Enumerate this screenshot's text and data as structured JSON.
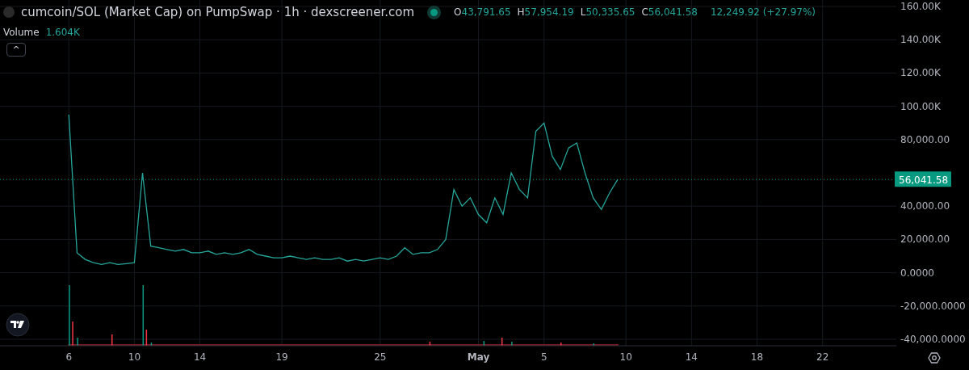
{
  "legend": {
    "title": "cumcoin/SOL (Market Cap) on PumpSwap · 1h · dexscreener.com",
    "ohlc": [
      {
        "letter": "O",
        "value": "43,791.65"
      },
      {
        "letter": "H",
        "value": "57,954.19"
      },
      {
        "letter": "L",
        "value": "50,335.65"
      },
      {
        "letter": "C",
        "value": "56,041.58"
      }
    ],
    "change": "12,249.92 (+27.97%)",
    "volume_label": "Volume",
    "volume_value": "1.604K",
    "collapse_button": "^"
  },
  "price_badge": "56,041.58",
  "may_axis_labels": [
    "May",
    "5",
    "10",
    "14",
    "18",
    "22"
  ],
  "chart_data": {
    "type": "line",
    "grid": true,
    "xlim": [
      1.8,
      56.5
    ],
    "ylim": [
      -40000,
      160000
    ],
    "xticks": [
      6,
      10,
      14,
      19,
      25
    ],
    "yticks": [
      {
        "value": 160000,
        "label": "160.00K"
      },
      {
        "value": 140000,
        "label": "140.00K"
      },
      {
        "value": 120000,
        "label": "120.00K"
      },
      {
        "value": 100000,
        "label": "100.00K"
      },
      {
        "value": 80000,
        "label": "80,000.00"
      },
      {
        "value": 40000,
        "label": "40,000.00"
      },
      {
        "value": 20000,
        "label": "20,000.00"
      },
      {
        "value": 0,
        "label": "0.0000"
      },
      {
        "value": -20000,
        "label": "-20,000.0000"
      },
      {
        "value": -40000,
        "label": "-40,000.0000"
      }
    ],
    "x": [
      6,
      6.5,
      7,
      7.5,
      8,
      8.5,
      9,
      9.5,
      10,
      10.5,
      11,
      11.5,
      12,
      12.5,
      13,
      13.5,
      14,
      14.5,
      15,
      15.5,
      16,
      16.5,
      17,
      17.5,
      18,
      18.5,
      19,
      19.5,
      20,
      20.5,
      21,
      21.5,
      22,
      22.5,
      23,
      23.5,
      24,
      24.5,
      25,
      25.5,
      26,
      26.5,
      27,
      27.5,
      28,
      28.5,
      29,
      29.5,
      30,
      30.5,
      31,
      31.5,
      32,
      32.5,
      33,
      33.5,
      34,
      34.5,
      35,
      35.5,
      36,
      36.5,
      37,
      37.5,
      38,
      38.5,
      39,
      39.5
    ],
    "series": [
      {
        "color": "#26a69a",
        "values": [
          95000,
          12000,
          8000,
          6000,
          5000,
          6000,
          5000,
          5500,
          6000,
          60000,
          16000,
          15000,
          14000,
          13000,
          14000,
          12000,
          12000,
          13000,
          11000,
          12000,
          11000,
          12000,
          14000,
          11000,
          10000,
          9000,
          9000,
          10000,
          9000,
          8000,
          9000,
          8000,
          8000,
          9000,
          7000,
          8000,
          7000,
          8000,
          9000,
          8000,
          10000,
          15000,
          11000,
          12000,
          12000,
          14000,
          20000,
          50000,
          40000,
          45000,
          35000,
          30000,
          45000,
          35000,
          60000,
          50000,
          45000,
          85000,
          90000,
          70000,
          62000,
          75000,
          78000,
          60000,
          45000,
          38000,
          48000,
          56000
        ]
      }
    ]
  }
}
